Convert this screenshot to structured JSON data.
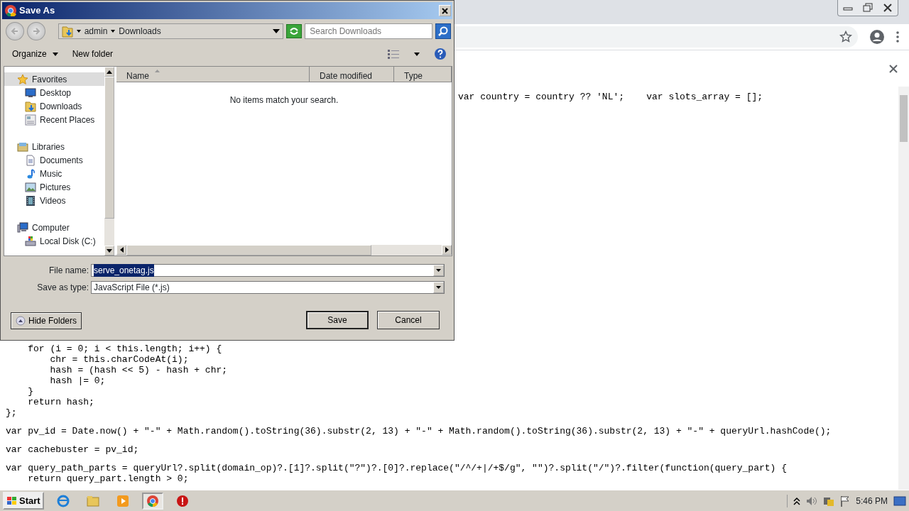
{
  "browser": {
    "code": {
      "tail_line": "var country = country ?? 'NL';    var slots_array = [];",
      "blocks": [
        [
          "    for (i = 0; i < this.length; i++) {",
          "        chr = this.charCodeAt(i);",
          "        hash = (hash << 5) - hash + chr;",
          "        hash |= 0;",
          "    }",
          "    return hash;",
          "};"
        ],
        [
          "var pv_id = Date.now() + \"-\" + Math.random().toString(36).substr(2, 13) + \"-\" + Math.random().toString(36).substr(2, 13) + \"-\" + queryUrl.hashCode();"
        ],
        [
          "var cachebuster = pv_id;"
        ],
        [
          "var query_path_parts = queryUrl?.split(domain_op)?.[1]?.split(\"?\")?.[0]?.replace(\"/^/+|/+$/g\", \"\")?.split(\"/\")?.filter(function(query_part) {",
          "    return query_part.length > 0;"
        ]
      ]
    }
  },
  "dialog": {
    "title": "Save As",
    "breadcrumb": [
      "admin",
      "Downloads"
    ],
    "search": {
      "placeholder": "Search Downloads"
    },
    "toolbar": [
      {
        "label": "Organize",
        "dropdown": true
      },
      {
        "label": "New folder",
        "dropdown": false
      }
    ],
    "nav": [
      {
        "label": "Favorites",
        "kind": "star",
        "selected": true,
        "children": [
          {
            "label": "Desktop",
            "kind": "desktop",
            "selected": false
          },
          {
            "label": "Downloads",
            "kind": "download",
            "selected": false
          },
          {
            "label": "Recent Places",
            "kind": "recent",
            "selected": false
          }
        ]
      },
      {
        "label": "Libraries",
        "kind": "library",
        "selected": false,
        "children": [
          {
            "label": "Documents",
            "kind": "document",
            "selected": false
          },
          {
            "label": "Music",
            "kind": "music",
            "selected": false
          },
          {
            "label": "Pictures",
            "kind": "pictures",
            "selected": false
          },
          {
            "label": "Videos",
            "kind": "videos",
            "selected": false
          }
        ]
      },
      {
        "label": "Computer",
        "kind": "computer",
        "selected": false,
        "children": [
          {
            "label": "Local Disk (C:)",
            "kind": "disk",
            "selected": false
          }
        ]
      }
    ],
    "columns": [
      {
        "label": "Name",
        "sorted": true
      },
      {
        "label": "Date modified",
        "sorted": false
      },
      {
        "label": "Type",
        "sorted": false
      }
    ],
    "empty_message": "No items match your search.",
    "file_name": {
      "label": "File name:",
      "value": "serve_onetag.js",
      "highlighted": true
    },
    "save_as_type": {
      "label": "Save as type:",
      "value": "JavaScript File (*.js)"
    },
    "hide_folders": "Hide Folders",
    "buttons": [
      {
        "label": "Save",
        "default": true
      },
      {
        "label": "Cancel",
        "default": false
      }
    ]
  },
  "taskbar": {
    "start": "Start",
    "apps": [
      {
        "kind": "ie",
        "selected": false
      },
      {
        "kind": "explorer",
        "selected": false
      },
      {
        "kind": "media",
        "selected": false
      },
      {
        "kind": "chrome",
        "selected": true
      },
      {
        "kind": "stop",
        "selected": false
      }
    ],
    "clock": "5:46 PM"
  }
}
